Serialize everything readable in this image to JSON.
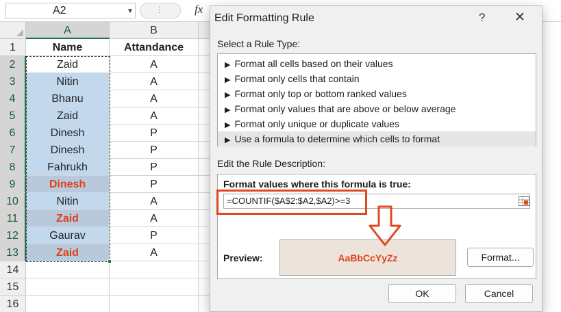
{
  "formula_bar": {
    "name_box": "A2",
    "fx_label": "fx"
  },
  "sheet": {
    "columns": [
      "A",
      "B"
    ],
    "headers": {
      "name": "Name",
      "attendance": "Attandance"
    },
    "rows": [
      {
        "num": "1"
      },
      {
        "num": "2",
        "name": "Zaid",
        "attendance": "A"
      },
      {
        "num": "3",
        "name": "Nitin",
        "attendance": "A"
      },
      {
        "num": "4",
        "name": "Bhanu",
        "attendance": "A"
      },
      {
        "num": "5",
        "name": "Zaid",
        "attendance": "A"
      },
      {
        "num": "6",
        "name": "Dinesh",
        "attendance": "P"
      },
      {
        "num": "7",
        "name": "Dinesh",
        "attendance": "P"
      },
      {
        "num": "8",
        "name": "Fahrukh",
        "attendance": "P"
      },
      {
        "num": "9",
        "name": "Dinesh",
        "attendance": "P"
      },
      {
        "num": "10",
        "name": "Nitin",
        "attendance": "A"
      },
      {
        "num": "11",
        "name": "Zaid",
        "attendance": "A"
      },
      {
        "num": "12",
        "name": "Gaurav",
        "attendance": "P"
      },
      {
        "num": "13",
        "name": "Zaid",
        "attendance": "A"
      },
      {
        "num": "14"
      },
      {
        "num": "15"
      },
      {
        "num": "16"
      }
    ]
  },
  "dialog": {
    "title": "Edit Formatting Rule",
    "help": "?",
    "close": "✕",
    "select_rule_label": "Select a Rule Type:",
    "rule_types": [
      "Format all cells based on their values",
      "Format only cells that contain",
      "Format only top or bottom ranked values",
      "Format only values that are above or below average",
      "Format only unique or duplicate values",
      "Use a formula to determine which cells to format"
    ],
    "selected_rule_index": 5,
    "edit_desc_label": "Edit the Rule Description:",
    "formula_prompt": "Format values where this formula is true:",
    "formula": "=COUNTIF($A$2:$A2,$A2)>=3",
    "preview_label": "Preview:",
    "preview_text": "AaBbCcYyZz",
    "format_button": "Format...",
    "ok_button": "OK",
    "cancel_button": "Cancel"
  },
  "colors": {
    "highlight_text": "#e0401c",
    "selection_fill": "#c2d8ed",
    "duplicate_fill": "#b7c9da",
    "annotation_red": "#e0481d",
    "excel_green": "#217346"
  },
  "icons": {
    "name_box_dropdown": "chevron-down-icon",
    "range_selector": "range-selector-icon",
    "rule_bullet": "triangle-right-icon",
    "annotation_arrow": "down-arrow-icon"
  }
}
